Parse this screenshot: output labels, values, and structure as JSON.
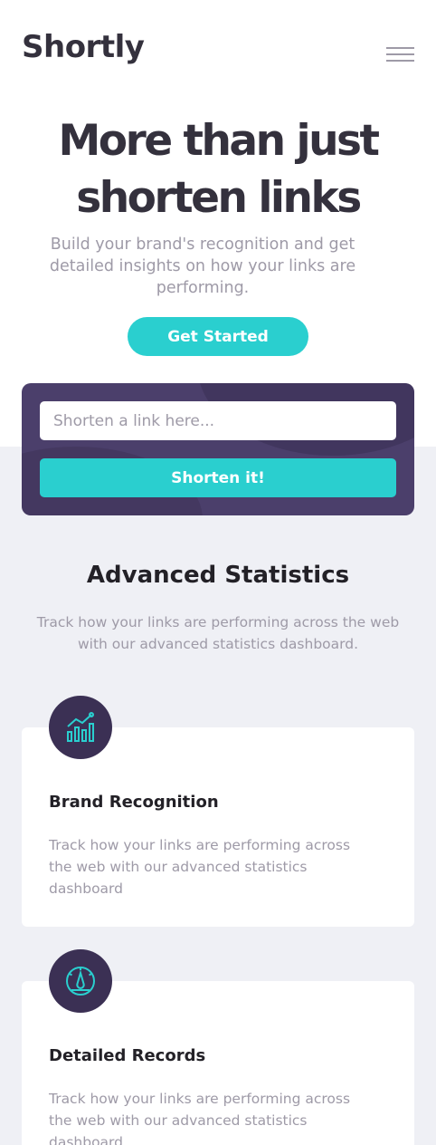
{
  "header": {
    "logo": "Shortly",
    "menu_icon": "hamburger-menu-icon"
  },
  "hero": {
    "title_line1": "More than just",
    "title_line2": "shorten links",
    "subtitle": "Build your brand's recognition and get detailed insights on how your links are performing.",
    "cta_label": "Get Started"
  },
  "shorten": {
    "placeholder": "Shorten a link here...",
    "button_label": "Shorten it!"
  },
  "stats": {
    "title": "Advanced Statistics",
    "subtitle": "Track how your links are performing across the web with our advanced statistics dashboard.",
    "cards": [
      {
        "icon": "bar-chart-icon",
        "title": "Brand Recognition",
        "text": "Track how your links are performing across the web with our advanced statistics dashboard"
      },
      {
        "icon": "gauge-icon",
        "title": "Detailed Records",
        "text": "Track how your links are performing across the web with our advanced statistics dashboard"
      }
    ]
  },
  "colors": {
    "cyan": "#2acfcf",
    "dark_violet": "#3b3054",
    "grey_violet": "#9e9aa7",
    "very_dark_blue": "#34313d",
    "light_grey_bg": "#eff0f5"
  }
}
